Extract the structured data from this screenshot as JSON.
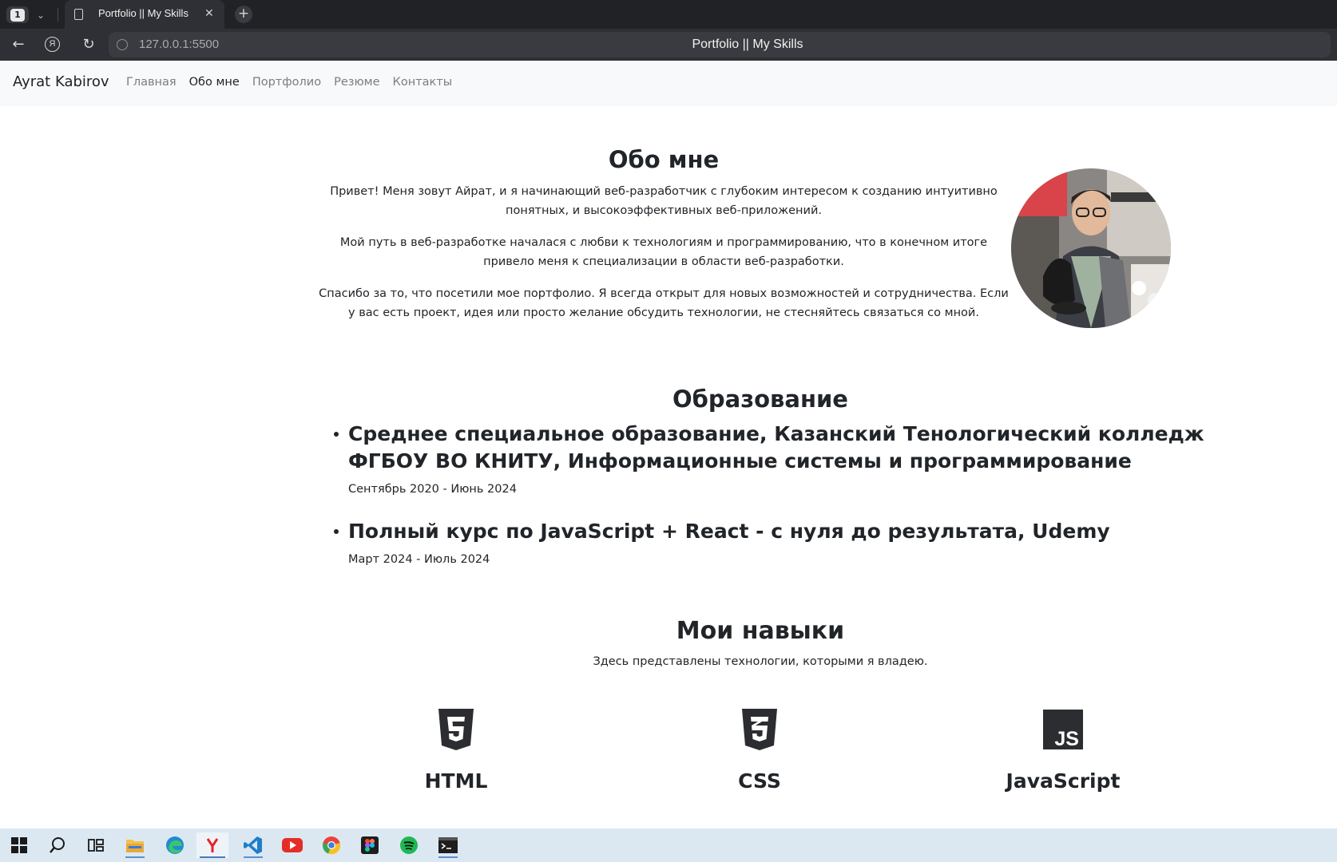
{
  "browser": {
    "tab_count": "1",
    "tab_title": "Portfolio || My Skills",
    "url": "127.0.0.1:5500",
    "page_title": "Portfolio || My Skills"
  },
  "navbar": {
    "brand": "Ayrat Kabirov",
    "links": [
      {
        "label": "Главная",
        "active": false
      },
      {
        "label": "Обо мне",
        "active": true
      },
      {
        "label": "Портфолио",
        "active": false
      },
      {
        "label": "Резюме",
        "active": false
      },
      {
        "label": "Контакты",
        "active": false
      }
    ]
  },
  "about": {
    "heading": "Обо мне",
    "paragraphs": [
      "Привет! Меня зовут Айрат, и я начинающий веб-разработчик с глубоким интересом к созданию интуитивно понятных, и высокоэффективных веб-приложений.",
      "Мой путь в веб-разработке началася с любви к технологиям и программированию, что в конечном итоге привело меня к специализации в области веб-разработки.",
      "Спасибо за то, что посетили мое портфолио. Я всегда открыт для новых возможностей и сотрудничества. Если у вас есть проект, идея или просто желание обсудить технологии, не стесняйтесь связаться со мной."
    ]
  },
  "education": {
    "heading": "Образование",
    "items": [
      {
        "title": "Среднее специальное образование, Казанский Тенологический колледж ФГБОУ ВО КНИТУ, Информационные системы и программирование",
        "date": "Сентябрь 2020 - Июнь 2024"
      },
      {
        "title": "Полный курс по JavaScript + React - с нуля до результата, Udemy",
        "date": "Март 2024 - Июль 2024"
      }
    ]
  },
  "skills": {
    "heading": "Мои навыки",
    "subtitle": "Здесь представлены технологии, которыми я владею.",
    "items": [
      {
        "label": "HTML",
        "icon": "html5-icon"
      },
      {
        "label": "CSS",
        "icon": "css3-icon"
      },
      {
        "label": "JavaScript",
        "icon": "javascript-icon",
        "badge": "JS"
      }
    ]
  },
  "taskbar": {
    "items": [
      "start-icon",
      "search-icon",
      "task-view-icon",
      "file-explorer-icon",
      "edge-icon",
      "yandex-browser-icon",
      "vscode-icon",
      "youtube-icon",
      "chrome-icon",
      "figma-icon",
      "spotify-icon",
      "terminal-icon"
    ]
  },
  "colors": {
    "text": "#212529",
    "nav_bg": "#f8f9fa",
    "browser_dark": "#212226",
    "taskbar": "#dce8f1"
  }
}
